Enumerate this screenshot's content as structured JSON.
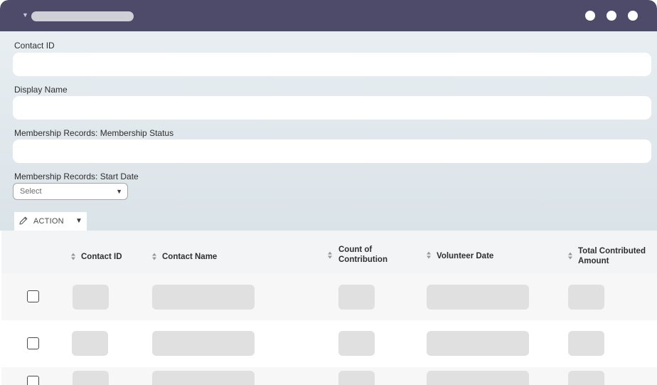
{
  "window": {
    "controls": [
      "dot-1",
      "dot-2",
      "dot-3"
    ]
  },
  "filters": {
    "contact_id_label": "Contact ID",
    "display_name_label": "Display Name",
    "membership_status_label": "Membership Records: Membership Status",
    "start_date_label": "Membership Records: Start Date",
    "start_date_select": "Select"
  },
  "toolbar": {
    "action_label": "ACTION"
  },
  "table": {
    "columns": {
      "contact_id": "Contact ID",
      "contact_name": "Contact Name",
      "count_line1": "Count of",
      "count_line2": "Contribution",
      "volunteer_date": "Volunteer Date",
      "total_line1": "Total Contributed",
      "total_line2": "Amount"
    }
  },
  "colors": {
    "titlebar": "#4e4b6a",
    "panel": "#e0e8ec",
    "placeholder": "#e0e0e0"
  }
}
